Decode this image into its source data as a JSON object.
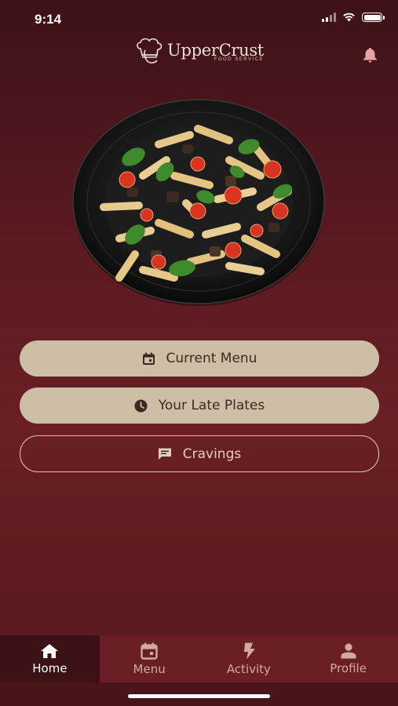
{
  "status_bar": {
    "time": "9:14"
  },
  "header": {
    "logo_name": "UpperCrust",
    "logo_sub": "FOOD SERVICE",
    "bell_icon": "bell-icon"
  },
  "colors": {
    "background": "#5a1a20",
    "button_fill": "#ccbfa6",
    "button_text": "#3a2a22",
    "tabbar": "#6a1e25",
    "tab_active": "#3c1216"
  },
  "buttons": {
    "current_menu": {
      "label": "Current Menu",
      "icon": "calendar-icon"
    },
    "late_plates": {
      "label": "Your Late Plates",
      "icon": "clock-icon"
    },
    "cravings": {
      "label": "Cravings",
      "icon": "chat-icon"
    }
  },
  "tabs": [
    {
      "label": "Home",
      "icon": "home-icon",
      "active": true
    },
    {
      "label": "Menu",
      "icon": "calendar-icon",
      "active": false
    },
    {
      "label": "Activity",
      "icon": "lightning-icon",
      "active": false
    },
    {
      "label": "Profile",
      "icon": "person-icon",
      "active": false
    }
  ]
}
